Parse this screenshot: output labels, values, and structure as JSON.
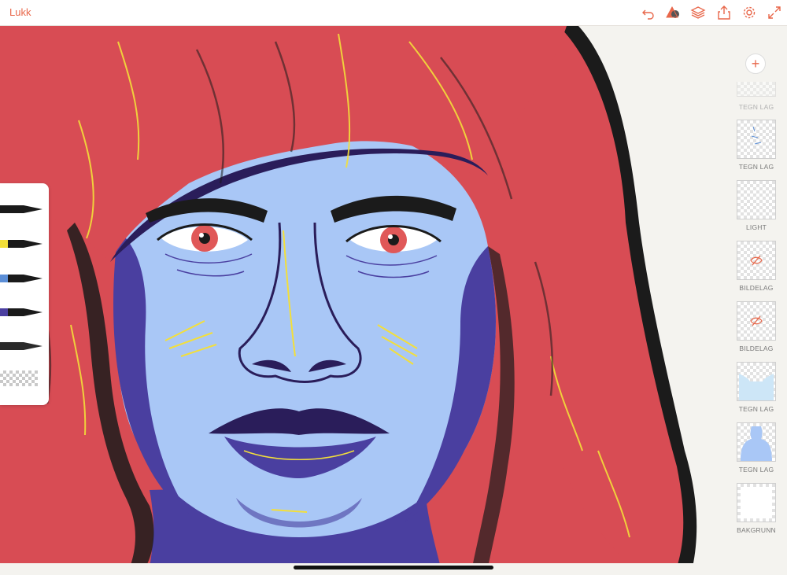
{
  "topbar": {
    "close_label": "Lukk",
    "icons": [
      "undo-icon",
      "shape-tools-icon",
      "layers-stack-icon",
      "share-icon",
      "settings-gear-icon",
      "fullscreen-icon"
    ]
  },
  "brushes": [
    {
      "name": "black-pen",
      "color": "#1a1a1a"
    },
    {
      "name": "yellow-pen",
      "color": "#f3df3a"
    },
    {
      "name": "blue-pen",
      "color": "#5b8ed6"
    },
    {
      "name": "purple-pen",
      "color": "#4b3fa0"
    },
    {
      "name": "dark-pen",
      "color": "#2a2a2a"
    }
  ],
  "layers": {
    "add_icon": "+",
    "items": [
      {
        "label": "TEGN LAG",
        "type": "partial"
      },
      {
        "label": "TEGN LAG",
        "type": "drawing"
      },
      {
        "label": "LIGHT",
        "type": "drawing"
      },
      {
        "label": "BILDELAG",
        "type": "hidden-image"
      },
      {
        "label": "BILDELAG",
        "type": "hidden-image"
      },
      {
        "label": "TEGN LAG",
        "type": "drawing"
      },
      {
        "label": "TEGN LAG",
        "type": "drawing"
      },
      {
        "label": "BAKGRUNN",
        "type": "background"
      }
    ]
  },
  "colors": {
    "accent": "#e8674a",
    "hair": "#d84c54",
    "skin": "#a9c7f6",
    "shadow": "#4a3fa0"
  }
}
